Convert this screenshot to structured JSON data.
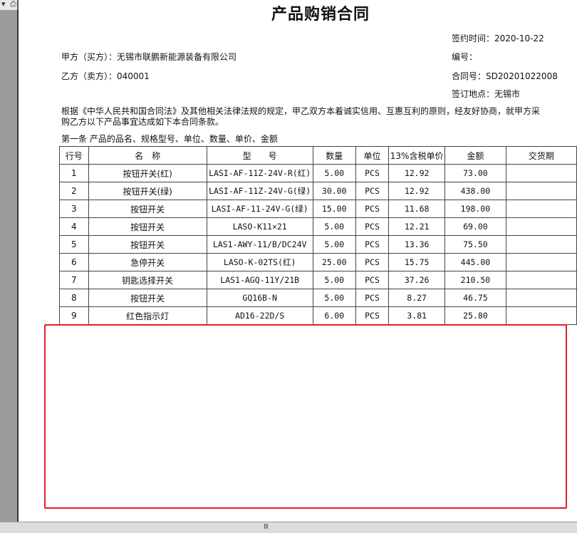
{
  "doc": {
    "title": "产品购销合同",
    "sign_date": "签约时间：2020-10-22",
    "party_a": "甲方（买方）：无锡市联鹏新能源装备有限公司",
    "party_b": "乙方（卖方）：040001",
    "serial_no": "编号：",
    "contract_no": "合同号：SD20201022008",
    "sign_place": "签订地点：无锡市",
    "preamble_1": "根据《中华人民共和国合同法》及其他相关法律法规的规定，甲乙双方本着诚实信用、互惠互利的原则，经友好协商，就甲方采",
    "preamble_2": "购乙方以下产品事宜达成如下本合同条款。",
    "article_1": "第一条   产品的品名、规格型号、单位、数量、单价、金额"
  },
  "table": {
    "headers": [
      "行号",
      "名　称",
      "型　　号",
      "数量",
      "单位",
      "13%含税单价",
      "金额",
      "交货期"
    ],
    "rows": [
      {
        "no": "1",
        "name": "按钮开关(红)",
        "model": "LASI-AF-11Z-24V-R(红)",
        "qty": "5.00",
        "unit": "PCS",
        "price": "12.92",
        "amount": "73.00",
        "date": ""
      },
      {
        "no": "2",
        "name": "按钮开关(绿)",
        "model": "LASI-AF-11Z-24V-G(绿)",
        "qty": "30.00",
        "unit": "PCS",
        "price": "12.92",
        "amount": "438.00",
        "date": ""
      },
      {
        "no": "3",
        "name": "按钮开关",
        "model": "LASI-AF-11-24V-G(绿)",
        "qty": "15.00",
        "unit": "PCS",
        "price": "11.68",
        "amount": "198.00",
        "date": ""
      },
      {
        "no": "4",
        "name": "按钮开关",
        "model": "LASO-K11×21",
        "qty": "5.00",
        "unit": "PCS",
        "price": "12.21",
        "amount": "69.00",
        "date": ""
      },
      {
        "no": "5",
        "name": "按钮开关",
        "model": "LAS1-AWY-11/B/DC24V",
        "qty": "5.00",
        "unit": "PCS",
        "price": "13.36",
        "amount": "75.50",
        "date": ""
      },
      {
        "no": "6",
        "name": "急停开关",
        "model": "LASO-K-02TS(红)",
        "qty": "25.00",
        "unit": "PCS",
        "price": "15.75",
        "amount": "445.00",
        "date": ""
      },
      {
        "no": "7",
        "name": "钥匙选择开关",
        "model": "LAS1-AGQ-11Y/21B",
        "qty": "5.00",
        "unit": "PCS",
        "price": "37.26",
        "amount": "210.50",
        "date": ""
      },
      {
        "no": "8",
        "name": "按钮开关",
        "model": "GQ16B-N",
        "qty": "5.00",
        "unit": "PCS",
        "price": "8.27",
        "amount": "46.75",
        "date": ""
      },
      {
        "no": "9",
        "name": "红色指示灯",
        "model": "AD16-22D/S",
        "qty": "6.00",
        "unit": "PCS",
        "price": "3.81",
        "amount": "25.80",
        "date": ""
      }
    ]
  },
  "statusbar": {
    "grip": "III"
  },
  "colors": {
    "highlight": "#e02020",
    "page_bg": "#ffffff",
    "viewer_bg": "#ababab"
  }
}
